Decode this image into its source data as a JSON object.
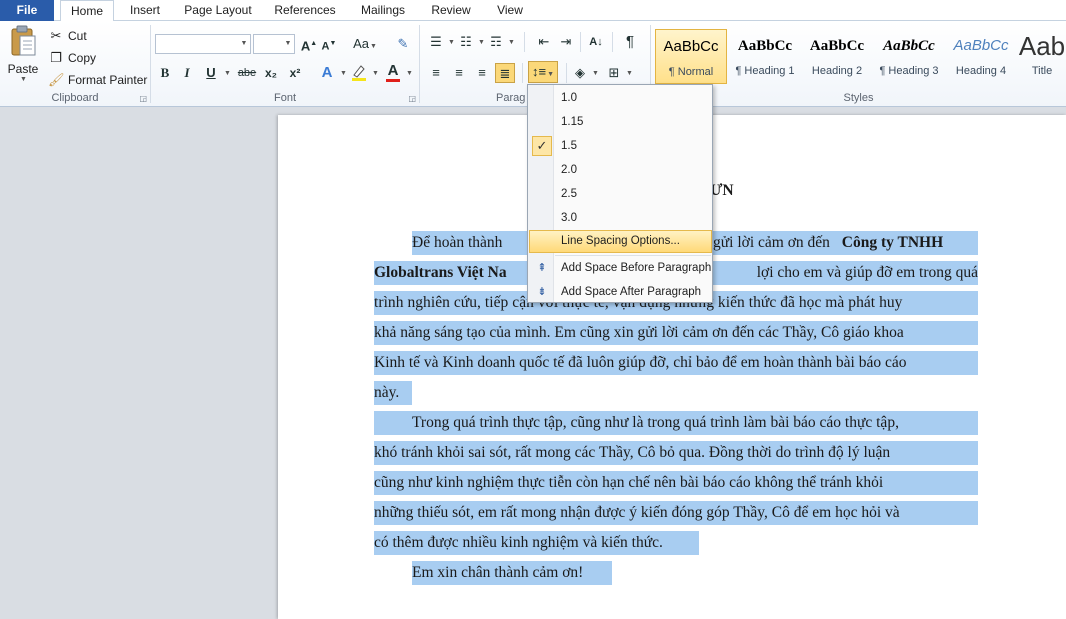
{
  "tabs": {
    "file": "File",
    "home": "Home",
    "insert": "Insert",
    "page_layout": "Page Layout",
    "references": "References",
    "mailings": "Mailings",
    "review": "Review",
    "view": "View"
  },
  "clipboard": {
    "paste": "Paste",
    "cut": "Cut",
    "copy": "Copy",
    "format_painter": "Format Painter",
    "label": "Clipboard"
  },
  "font": {
    "label": "Font",
    "font_name": "",
    "font_size": "",
    "bold": "B",
    "italic": "I",
    "underline": "U",
    "strike": "abe",
    "subscript": "x₂",
    "superscript": "x²",
    "change_case": "Aa"
  },
  "paragraph": {
    "label": "Parag"
  },
  "styles": {
    "label": "Styles",
    "items": [
      {
        "sample": "AaBbCc",
        "name": "¶ Normal"
      },
      {
        "sample": "AaBbCc",
        "name": "¶ Heading 1"
      },
      {
        "sample": "AaBbCc",
        "name": "Heading 2"
      },
      {
        "sample": "AaBbCc",
        "name": "¶ Heading 3"
      },
      {
        "sample": "AaBbCc",
        "name": "Heading 4"
      },
      {
        "sample": "Aab",
        "name": "Title"
      }
    ]
  },
  "line_spacing_menu": {
    "options": [
      "1.0",
      "1.15",
      "1.5",
      "2.0",
      "2.5",
      "3.0"
    ],
    "checked": "1.5",
    "options_item": "Line Spacing Options...",
    "add_before": "Add Space Before Paragraph",
    "add_after": "Add Space After Paragraph"
  },
  "document": {
    "heading_fragment": "ƯN",
    "p1": {
      "l1_a": "Để hoàn thành",
      "l1_b": "gửi lời cảm ơn đến",
      "l1_c": "Công ty TNHH",
      "l2_a": "Globaltrans Việt Na",
      "l2_b": "lợi cho em và giúp đỡ em trong quá",
      "l3": "trình nghiên cứu, tiếp cận với thực tế, vận dụng những kiến thức đã học mà phát huy",
      "l4": "khả năng sáng tạo của mình. Em cũng xin gửi lời cảm ơn đến các Thầy, Cô giáo khoa",
      "l5": "Kinh tế và Kinh doanh quốc tế đã luôn giúp đỡ, chỉ bảo để em hoàn thành bài báo cáo",
      "l6": "này."
    },
    "p2": {
      "l1": "Trong quá trình thực tập, cũng như là trong quá trình làm bài báo cáo thực tập,",
      "l2": "khó tránh khỏi sai sót, rất mong các Thầy, Cô bỏ qua. Đồng thời do trình độ lý luận",
      "l3": "cũng như kinh nghiệm thực tiễn còn hạn chế nên bài báo cáo không thể tránh khỏi",
      "l4": "những thiếu sót, em rất mong nhận được ý kiến đóng góp Thầy, Cô để em học hỏi và",
      "l5": "có thêm được nhiều kinh nghiệm và kiến thức."
    },
    "p3": "Em xin chân thành cảm ơn!"
  },
  "colors": {
    "file_tab": "#2a5caa",
    "selection": "#a8cdf1",
    "menu_highlight": "#ffd978"
  }
}
